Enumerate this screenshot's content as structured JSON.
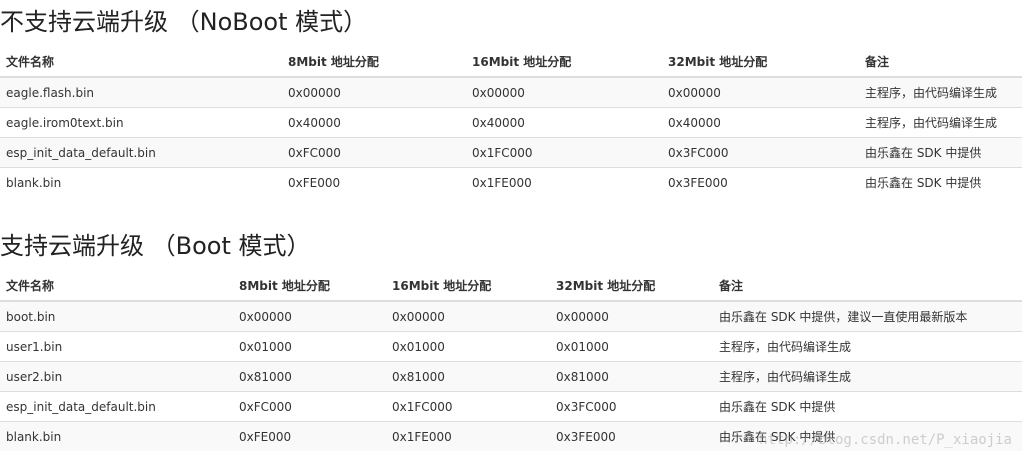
{
  "sections": [
    {
      "title": "不支持云端升级 （NoBoot 模式）",
      "headers": [
        "文件名称",
        "8Mbit 地址分配",
        "16Mbit 地址分配",
        "32Mbit 地址分配",
        "备注"
      ],
      "rows": [
        [
          "eagle.flash.bin",
          "0x00000",
          "0x00000",
          "0x00000",
          "主程序，由代码编译生成"
        ],
        [
          "eagle.irom0text.bin",
          "0x40000",
          "0x40000",
          "0x40000",
          "主程序，由代码编译生成"
        ],
        [
          "esp_init_data_default.bin",
          "0xFC000",
          "0x1FC000",
          "0x3FC000",
          "由乐鑫在 SDK 中提供"
        ],
        [
          "blank.bin",
          "0xFE000",
          "0x1FE000",
          "0x3FE000",
          "由乐鑫在 SDK 中提供"
        ]
      ]
    },
    {
      "title": "支持云端升级 （Boot 模式）",
      "headers": [
        "文件名称",
        "8Mbit 地址分配",
        "16Mbit 地址分配",
        "32Mbit 地址分配",
        "备注"
      ],
      "rows": [
        [
          "boot.bin",
          "0x00000",
          "0x00000",
          "0x00000",
          "由乐鑫在 SDK 中提供，建议一直使用最新版本"
        ],
        [
          "user1.bin",
          "0x01000",
          "0x01000",
          "0x01000",
          "主程序，由代码编译生成"
        ],
        [
          "user2.bin",
          "0x81000",
          "0x81000",
          "0x81000",
          "主程序，由代码编译生成"
        ],
        [
          "esp_init_data_default.bin",
          "0xFC000",
          "0x1FC000",
          "0x3FC000",
          "由乐鑫在 SDK 中提供"
        ],
        [
          "blank.bin",
          "0xFE000",
          "0x1FE000",
          "0x3FE000",
          "由乐鑫在 SDK 中提供"
        ]
      ]
    }
  ],
  "watermark": "http://blog.csdn.net/P_xiaojia"
}
